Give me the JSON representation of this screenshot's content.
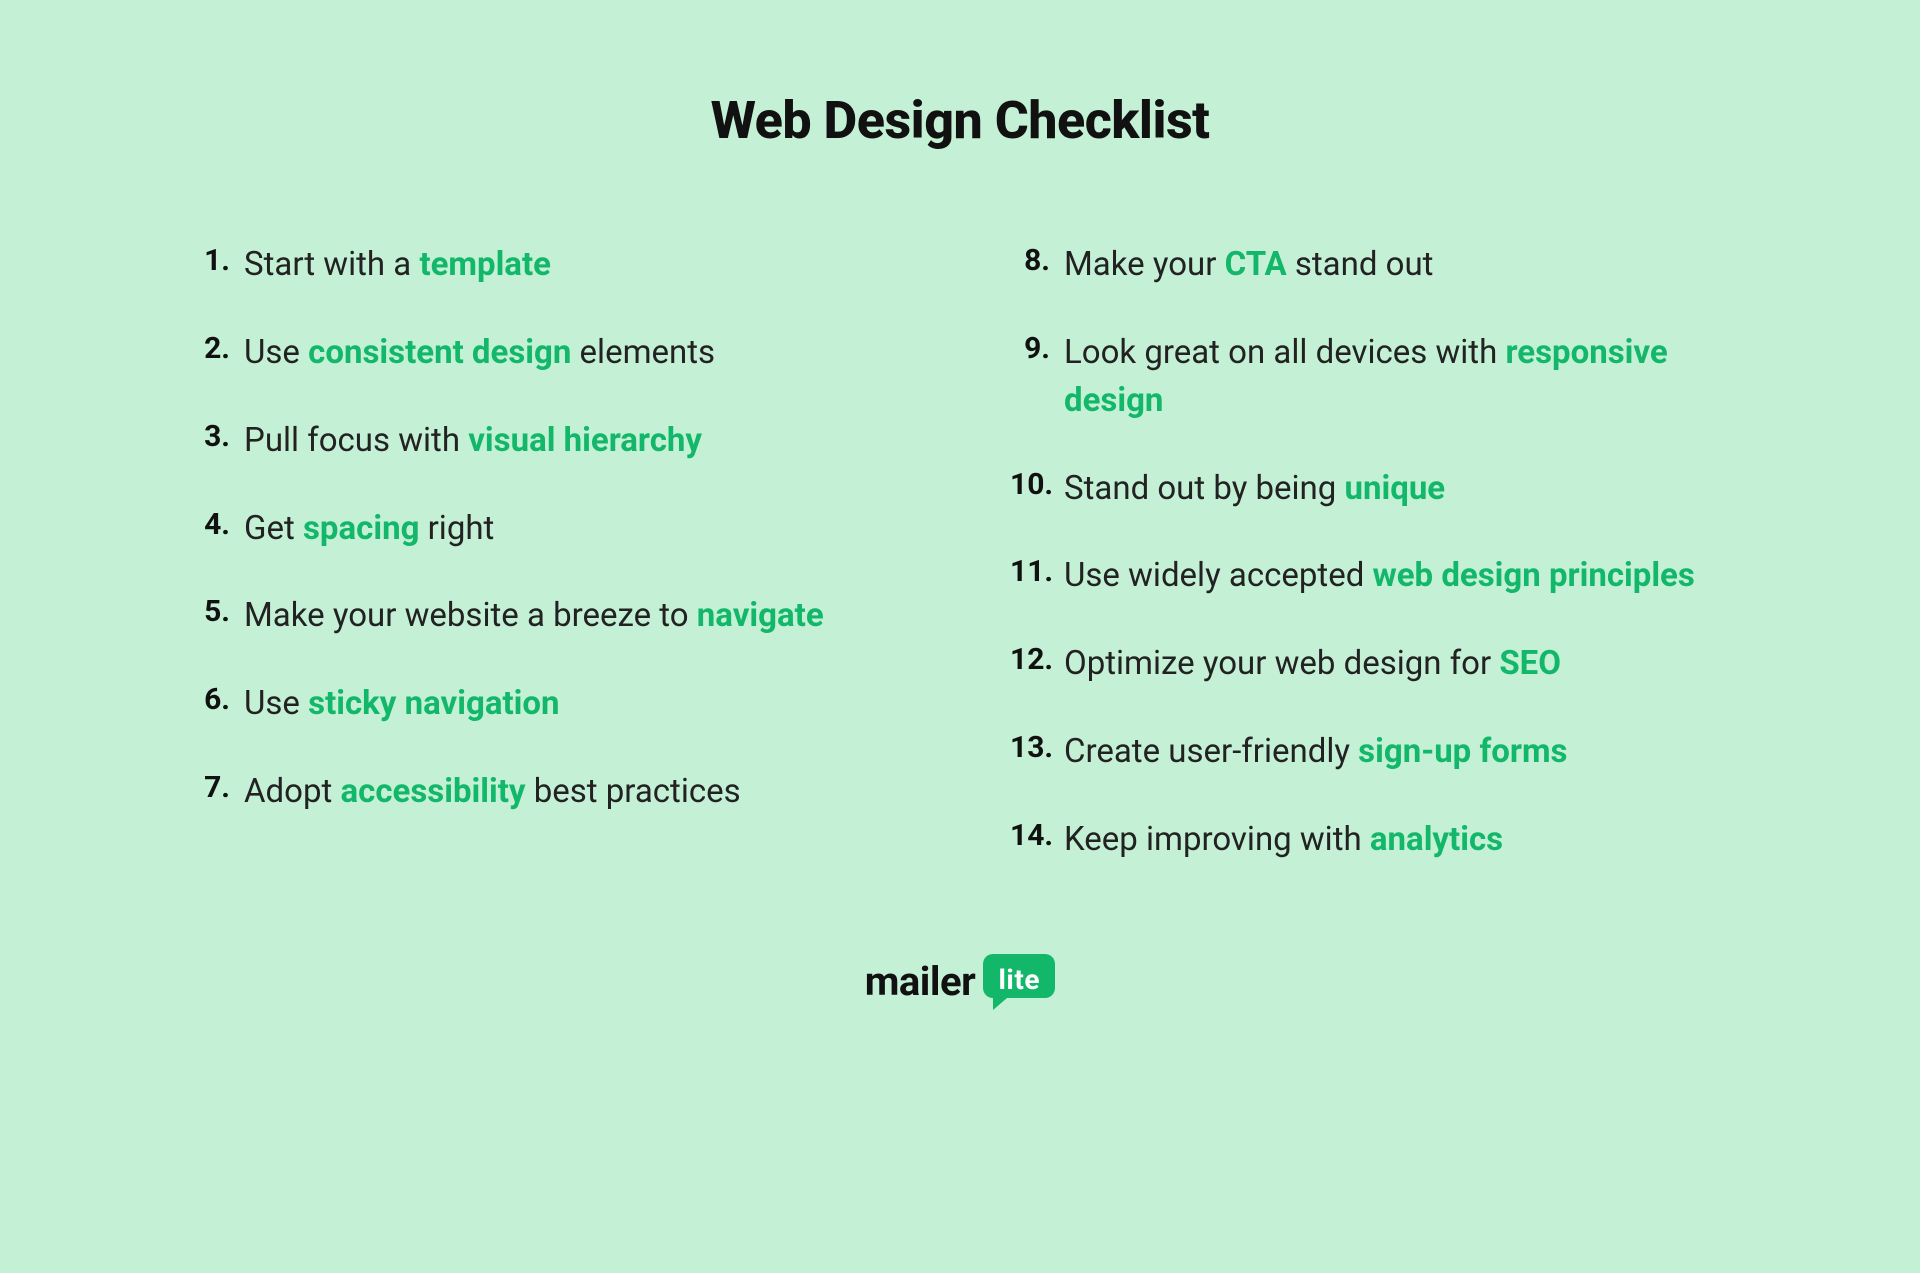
{
  "title": "Web Design Checklist",
  "accent_color": "#12b76a",
  "background_color": "#c4f0d6",
  "items": [
    {
      "n": "1.",
      "parts": [
        {
          "t": "Start with a "
        },
        {
          "t": "template",
          "hl": true
        }
      ]
    },
    {
      "n": "2.",
      "parts": [
        {
          "t": "Use "
        },
        {
          "t": "consistent design",
          "hl": true
        },
        {
          "t": " elements"
        }
      ]
    },
    {
      "n": "3.",
      "parts": [
        {
          "t": "Pull focus with "
        },
        {
          "t": "visual hierarchy",
          "hl": true
        }
      ]
    },
    {
      "n": "4.",
      "parts": [
        {
          "t": "Get "
        },
        {
          "t": "spacing",
          "hl": true
        },
        {
          "t": " right"
        }
      ]
    },
    {
      "n": "5.",
      "parts": [
        {
          "t": "Make your website a breeze to "
        },
        {
          "t": "navigate",
          "hl": true
        }
      ]
    },
    {
      "n": "6.",
      "parts": [
        {
          "t": "Use "
        },
        {
          "t": "sticky navigation",
          "hl": true
        }
      ]
    },
    {
      "n": "7.",
      "parts": [
        {
          "t": "Adopt "
        },
        {
          "t": "accessibility",
          "hl": true
        },
        {
          "t": " best practices"
        }
      ]
    },
    {
      "n": "8.",
      "parts": [
        {
          "t": "Make your "
        },
        {
          "t": "CTA",
          "hl": true
        },
        {
          "t": " stand out"
        }
      ]
    },
    {
      "n": "9.",
      "parts": [
        {
          "t": "Look great on all devices with "
        },
        {
          "t": "responsive design",
          "hl": true
        }
      ]
    },
    {
      "n": "10.",
      "parts": [
        {
          "t": "Stand out by being "
        },
        {
          "t": "unique",
          "hl": true
        }
      ]
    },
    {
      "n": "11.",
      "parts": [
        {
          "t": "Use widely accepted "
        },
        {
          "t": "web design principles",
          "hl": true
        }
      ]
    },
    {
      "n": "12.",
      "parts": [
        {
          "t": "Optimize your web design for "
        },
        {
          "t": "SEO",
          "hl": true
        }
      ]
    },
    {
      "n": "13.",
      "parts": [
        {
          "t": "Create user-friendly "
        },
        {
          "t": "sign-up forms",
          "hl": true
        }
      ]
    },
    {
      "n": "14.",
      "parts": [
        {
          "t": "Keep improving with "
        },
        {
          "t": "analytics",
          "hl": true
        }
      ]
    }
  ],
  "split_after": 7,
  "logo": {
    "mailer": "mailer",
    "lite": "lite"
  }
}
